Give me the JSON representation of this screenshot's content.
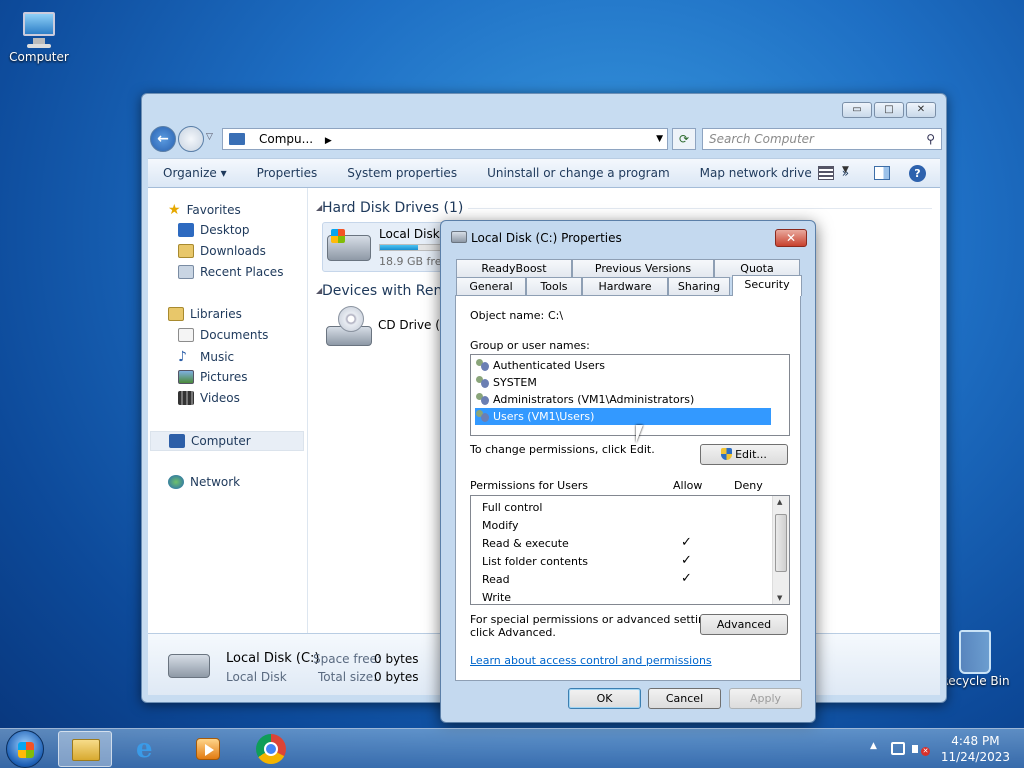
{
  "desktop": {
    "computer_label": "Computer",
    "recycle_label": "Recycle Bin"
  },
  "explorer": {
    "address": "Compu...",
    "search_placeholder": "Search Computer",
    "toolbar": [
      "Organize ▾",
      "Properties",
      "System properties",
      "Uninstall or change a program",
      "Map network drive",
      "»"
    ],
    "nav": {
      "favorites": "Favorites",
      "desktop": "Desktop",
      "downloads": "Downloads",
      "recent": "Recent Places",
      "libraries": "Libraries",
      "documents": "Documents",
      "music": "Music",
      "pictures": "Pictures",
      "videos": "Videos",
      "computer": "Computer",
      "network": "Network"
    },
    "hdd_header": "Hard Disk Drives (1)",
    "devices_header": "Devices with Ren",
    "disk_name": "Local Disk (",
    "disk_free": "18.9 GB free",
    "disk_fill": 0.6,
    "cd_name": "CD Drive (D",
    "details": {
      "name": "Local Disk (C:)",
      "type": "Local Disk",
      "space_free_label": "Space free:",
      "space_free": "0 bytes",
      "total_label": "Total size:",
      "total": "0 bytes"
    }
  },
  "dialog": {
    "title": "Local Disk (C:) Properties",
    "tabs_top": [
      "ReadyBoost",
      "Previous Versions",
      "Quota"
    ],
    "tabs_bottom": [
      "General",
      "Tools",
      "Hardware",
      "Sharing",
      "Security"
    ],
    "object_label": "Object name:",
    "object_value": "C:\\",
    "group_label": "Group or user names:",
    "users": [
      "Authenticated Users",
      "SYSTEM",
      "Administrators (VM1\\Administrators)",
      "Users (VM1\\Users)"
    ],
    "change_text": "To change permissions, click Edit.",
    "edit_button": "Edit...",
    "perm_label": "Permissions for Users",
    "allow_label": "Allow",
    "deny_label": "Deny",
    "permissions": [
      "Full control",
      "Modify",
      "Read & execute",
      "List folder contents",
      "Read",
      "Write"
    ],
    "check_mark": "✓",
    "special_text_1": "For special permissions or advanced settings,",
    "special_text_2": "click Advanced.",
    "advanced_button": "Advanced",
    "learn_link": "Learn about access control and permissions",
    "ok": "OK",
    "cancel": "Cancel",
    "apply": "Apply"
  },
  "taskbar": {
    "time": "4:48 PM",
    "date": "11/24/2023"
  }
}
